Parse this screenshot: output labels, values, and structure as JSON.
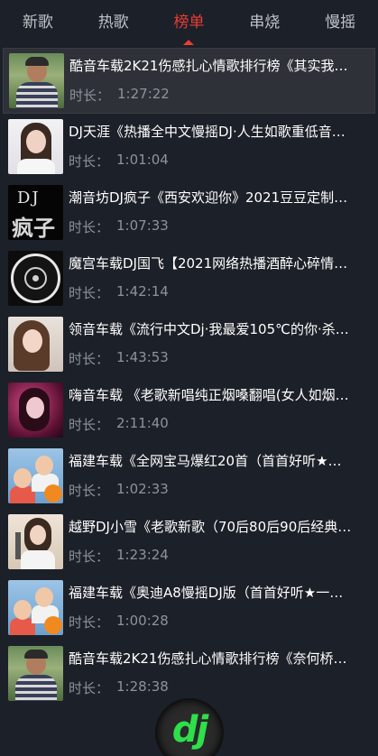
{
  "tabs": [
    {
      "label": "新歌"
    },
    {
      "label": "热歌"
    },
    {
      "label": "榜单"
    },
    {
      "label": "串烧"
    },
    {
      "label": "慢摇"
    }
  ],
  "active_tab": "榜单",
  "duration_label": "时长：",
  "songs": [
    {
      "title": "酷音车载2K21伤感扎心情歌排行榜《其实我…",
      "duration": "1:27:22",
      "thumb": "man-in-striped-shirt"
    },
    {
      "title": "DJ天涯《热播全中文慢摇DJ·人生如歌重低音…",
      "duration": "1:01:04",
      "thumb": "woman-portrait"
    },
    {
      "title": "潮音坊DJ疯子《西安欢迎你》2021豆豆定制…",
      "duration": "1:07:33",
      "thumb": "dj-logo"
    },
    {
      "title": "魔宫车载DJ国飞【2021网络热播酒醉心碎情…",
      "duration": "1:42:14",
      "thumb": "disc-logo"
    },
    {
      "title": "领音车载《流行中文Dj·我最爱105℃的你·杀…",
      "duration": "1:43:53",
      "thumb": "woman-portrait"
    },
    {
      "title": "嗨音车载 《老歌新唱纯正烟嗓翻唱(女人如烟…",
      "duration": "2:11:40",
      "thumb": "woman-neon"
    },
    {
      "title": "福建车载《全网宝马爆红20首（首首好听★…",
      "duration": "1:02:33",
      "thumb": "kids-with-ball"
    },
    {
      "title": "越野DJ小雪《老歌新歌（70后80后90后经典…",
      "duration": "1:23:24",
      "thumb": "singer-with-mic"
    },
    {
      "title": "福建车载《奥迪A8慢摇DJ版（首首好听★一…",
      "duration": "1:00:28",
      "thumb": "kids-with-ball"
    },
    {
      "title": "酷音车载2K21伤感扎心情歌排行榜《奈何桥…",
      "duration": "1:28:38",
      "thumb": "man-in-striped-shirt"
    }
  ],
  "dj_button": {
    "label": "dj",
    "icon": "dj-logo-icon"
  },
  "colors": {
    "background": "#1c2028",
    "accent": "#e83c36",
    "dj_green": "#2ee04a"
  }
}
